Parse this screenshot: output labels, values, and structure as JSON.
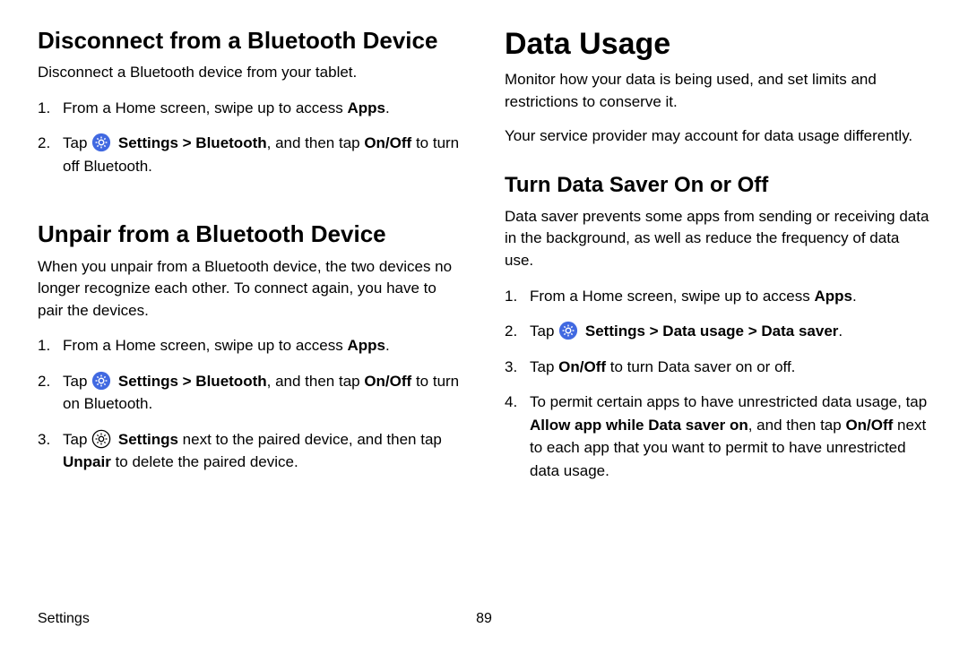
{
  "footer": {
    "section": "Settings",
    "page": "89"
  },
  "left": {
    "h_disconnect": "Disconnect from a Bluetooth Device",
    "p_disconnect": "Disconnect a Bluetooth device from your tablet.",
    "steps_disconnect": {
      "s1_a": "From a Home screen, swipe up to access ",
      "s1_b": "Apps",
      "s1_c": ".",
      "s2_a": "Tap ",
      "s2_b": "Settings > Bluetooth",
      "s2_c": ", and then tap ",
      "s2_d": "On/Off",
      "s2_e": " to turn off Bluetooth."
    },
    "h_unpair": "Unpair from a Bluetooth Device",
    "p_unpair": "When you unpair from a Bluetooth device, the two devices no longer recognize each other. To connect again, you have to pair the devices.",
    "steps_unpair": {
      "s1_a": "From a Home screen, swipe up to access ",
      "s1_b": "Apps",
      "s1_c": ".",
      "s2_a": "Tap ",
      "s2_b": "Settings > Bluetooth",
      "s2_c": ", and then tap ",
      "s2_d": "On/Off",
      "s2_e": " to turn on Bluetooth.",
      "s3_a": "Tap ",
      "s3_b": "Settings",
      "s3_c": " next to the paired device, and then tap ",
      "s3_d": "Unpair",
      "s3_e": " to delete the paired device."
    }
  },
  "right": {
    "h_data": "Data Usage",
    "p_data1": "Monitor how your data is being used, and set limits and restrictions to conserve it.",
    "p_data2": "Your service provider may account for data usage differently.",
    "h_saver": "Turn Data Saver On or Off",
    "p_saver": "Data saver prevents some apps from sending or receiving data in the background, as well as reduce the frequency of data use.",
    "steps_saver": {
      "s1_a": "From a Home screen, swipe up to access ",
      "s1_b": "Apps",
      "s1_c": ".",
      "s2_a": "Tap ",
      "s2_b": "Settings > Data usage > Data saver",
      "s2_c": ".",
      "s3_a": "Tap ",
      "s3_b": "On/Off",
      "s3_c": " to turn Data saver on or off.",
      "s4_a": "To permit certain apps to have unrestricted data usage, tap ",
      "s4_b": "Allow app while Data saver on",
      "s4_c": ", and then tap ",
      "s4_d": "On/Off",
      "s4_e": " next to each app that you want to permit to have unrestricted data usage."
    }
  }
}
